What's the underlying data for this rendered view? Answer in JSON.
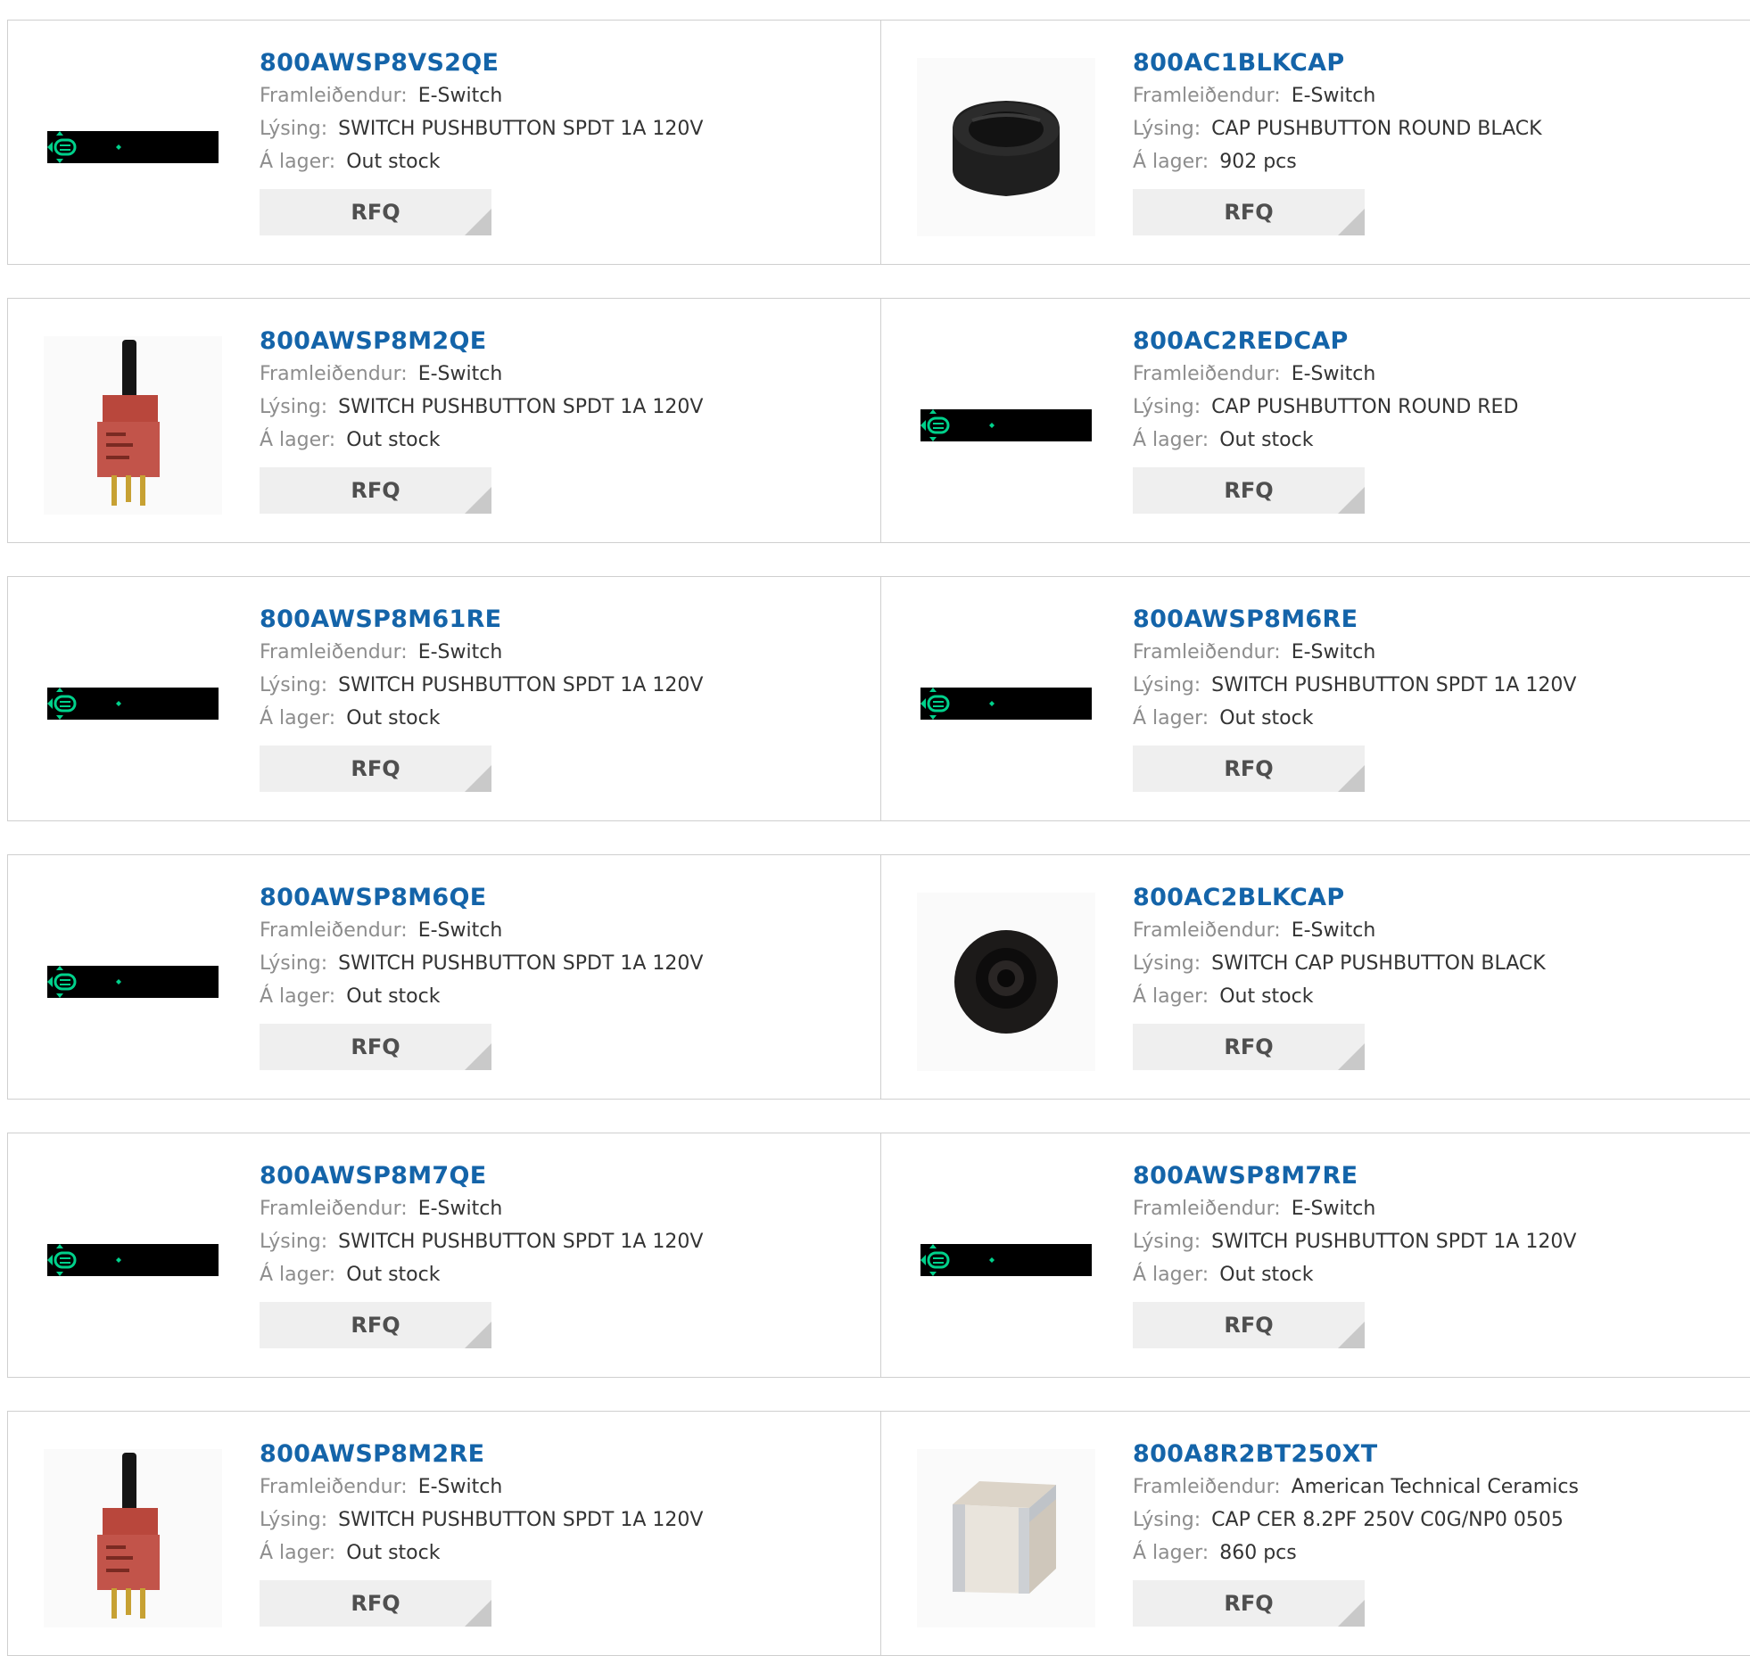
{
  "labels": {
    "manufacturer": "Framleiðendur:",
    "description": "Lýsing:",
    "stock": "Á lager:",
    "rfq": "RFQ"
  },
  "products": [
    {
      "pn": "800AWSP8VS2QE",
      "manufacturer": "E-Switch",
      "description": "SWITCH PUSHBUTTON SPDT 1A 120V",
      "stock": "Out stock",
      "image": "placeholder"
    },
    {
      "pn": "800AC1BLKCAP",
      "manufacturer": "E-Switch",
      "description": "CAP PUSHBUTTON ROUND BLACK",
      "stock": "902 pcs",
      "image": "black-cap"
    },
    {
      "pn": "800AWSP8M2QE",
      "manufacturer": "E-Switch",
      "description": "SWITCH PUSHBUTTON SPDT 1A 120V",
      "stock": "Out stock",
      "image": "red-switch"
    },
    {
      "pn": "800AC2REDCAP",
      "manufacturer": "E-Switch",
      "description": "CAP PUSHBUTTON ROUND RED",
      "stock": "Out stock",
      "image": "placeholder"
    },
    {
      "pn": "800AWSP8M61RE",
      "manufacturer": "E-Switch",
      "description": "SWITCH PUSHBUTTON SPDT 1A 120V",
      "stock": "Out stock",
      "image": "placeholder"
    },
    {
      "pn": "800AWSP8M6RE",
      "manufacturer": "E-Switch",
      "description": "SWITCH PUSHBUTTON SPDT 1A 120V",
      "stock": "Out stock",
      "image": "placeholder"
    },
    {
      "pn": "800AWSP8M6QE",
      "manufacturer": "E-Switch",
      "description": "SWITCH PUSHBUTTON SPDT 1A 120V",
      "stock": "Out stock",
      "image": "placeholder"
    },
    {
      "pn": "800AC2BLKCAP",
      "manufacturer": "E-Switch",
      "description": "SWITCH CAP PUSHBUTTON BLACK",
      "stock": "Out stock",
      "image": "black-cap-top"
    },
    {
      "pn": "800AWSP8M7QE",
      "manufacturer": "E-Switch",
      "description": "SWITCH PUSHBUTTON SPDT 1A 120V",
      "stock": "Out stock",
      "image": "placeholder"
    },
    {
      "pn": "800AWSP8M7RE",
      "manufacturer": "E-Switch",
      "description": "SWITCH PUSHBUTTON SPDT 1A 120V",
      "stock": "Out stock",
      "image": "placeholder"
    },
    {
      "pn": "800AWSP8M2RE",
      "manufacturer": "E-Switch",
      "description": "SWITCH PUSHBUTTON SPDT 1A 120V",
      "stock": "Out stock",
      "image": "red-switch"
    },
    {
      "pn": "800A8R2BT250XT",
      "manufacturer": "American Technical Ceramics",
      "description": "CAP CER 8.2PF 250V C0G/NP0 0505",
      "stock": "860 pcs",
      "image": "ceramic-cap"
    }
  ]
}
